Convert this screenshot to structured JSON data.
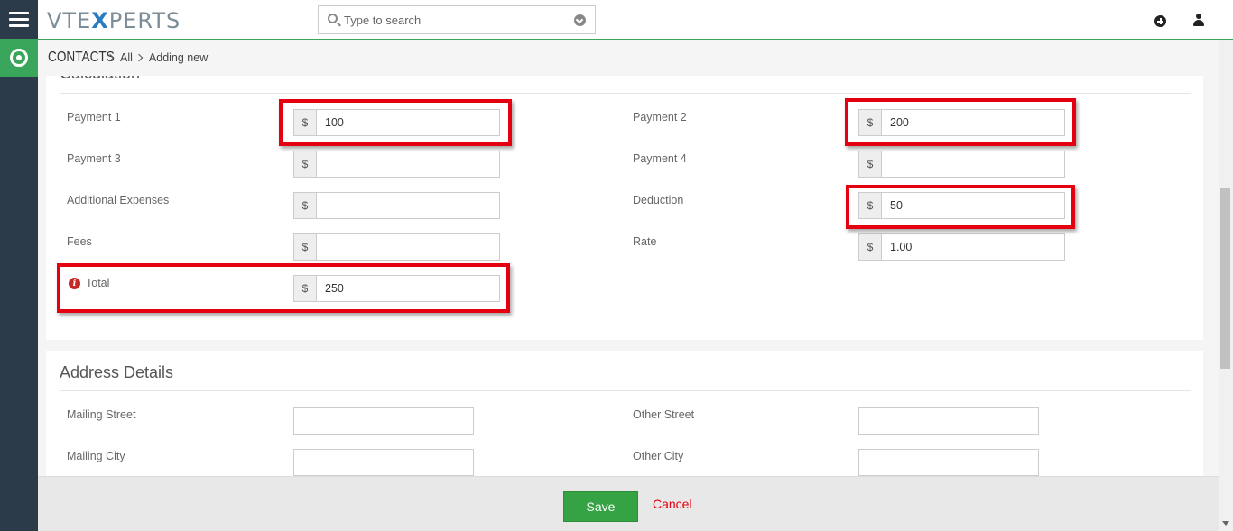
{
  "app": {
    "logo": {
      "pre": "VTE",
      "x": "X",
      "post": "PERTS"
    }
  },
  "search": {
    "placeholder": "Type to search"
  },
  "breadcrumb": {
    "module": "CONTACTS",
    "level1": "All",
    "level2": "Adding new"
  },
  "calculation": {
    "title": "Calculation",
    "currency": "$",
    "payment1": {
      "label": "Payment 1",
      "value": "100"
    },
    "payment2": {
      "label": "Payment 2",
      "value": "200"
    },
    "payment3": {
      "label": "Payment 3",
      "value": ""
    },
    "payment4": {
      "label": "Payment 4",
      "value": ""
    },
    "additional_expenses": {
      "label": "Additional Expenses",
      "value": ""
    },
    "deduction": {
      "label": "Deduction",
      "value": "50"
    },
    "fees": {
      "label": "Fees",
      "value": ""
    },
    "rate": {
      "label": "Rate",
      "value": "1.00"
    },
    "total": {
      "label": "Total",
      "value": "250"
    }
  },
  "address": {
    "title": "Address Details",
    "mailing_street": {
      "label": "Mailing Street",
      "value": ""
    },
    "other_street": {
      "label": "Other Street",
      "value": ""
    },
    "mailing_city": {
      "label": "Mailing City",
      "value": ""
    },
    "other_city": {
      "label": "Other City",
      "value": ""
    }
  },
  "footer": {
    "save_label": "Save",
    "cancel_label": "Cancel"
  },
  "colors": {
    "accent": "#3aa65c",
    "highlight": "#e4000f",
    "rail": "#2c3b49"
  }
}
